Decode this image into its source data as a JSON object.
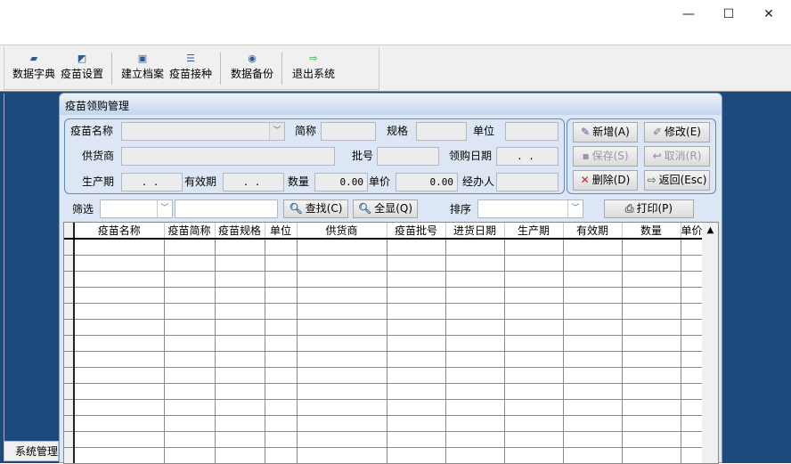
{
  "window": {
    "minimize": "—",
    "maximize": "☐",
    "close": "✕"
  },
  "toolbar": {
    "items": [
      {
        "label": "数据字典",
        "icon": "book-icon"
      },
      {
        "label": "疫苗设置",
        "icon": "settings-icon"
      },
      {
        "label": "建立档案",
        "icon": "archive-icon"
      },
      {
        "label": "疫苗接种",
        "icon": "list-icon"
      },
      {
        "label": "数据备份",
        "icon": "backup-icon"
      },
      {
        "label": "退出系统",
        "icon": "exit-icon"
      }
    ]
  },
  "left_panel": {
    "footer": "系统管理"
  },
  "dialog": {
    "title": "疫苗领购管理",
    "form": {
      "vaccine_name": {
        "label": "疫苗名称",
        "value": ""
      },
      "short_name": {
        "label": "简称",
        "value": ""
      },
      "spec": {
        "label": "规格",
        "value": ""
      },
      "unit": {
        "label": "单位",
        "value": ""
      },
      "supplier": {
        "label": "供货商",
        "value": ""
      },
      "batch": {
        "label": "批号",
        "value": ""
      },
      "purchase_date": {
        "label": "领购日期",
        "value": ". ."
      },
      "production_date": {
        "label": "生产期",
        "value": ". ."
      },
      "expiry": {
        "label": "有效期",
        "value": ". ."
      },
      "quantity": {
        "label": "数量",
        "value": "0.00"
      },
      "price": {
        "label": "单价",
        "value": "0.00"
      },
      "handler": {
        "label": "经办人",
        "value": ""
      }
    },
    "buttons": {
      "add": "新增(A)",
      "edit": "修改(E)",
      "save": "保存(S)",
      "cancel": "取消(R)",
      "delete": "删除(D)",
      "back": "返回(Esc)",
      "find": "查找(C)",
      "show_all": "全显(Q)",
      "print": "打印(P)"
    },
    "filter": {
      "label": "筛选",
      "field_value": "",
      "text_value": ""
    },
    "sort": {
      "label": "排序",
      "value": ""
    },
    "table": {
      "columns": [
        "疫苗名称",
        "疫苗简称",
        "疫苗规格",
        "单位",
        "供货商",
        "疫苗批号",
        "进货日期",
        "生产期",
        "有效期",
        "数量",
        "单价"
      ],
      "rows": []
    }
  }
}
